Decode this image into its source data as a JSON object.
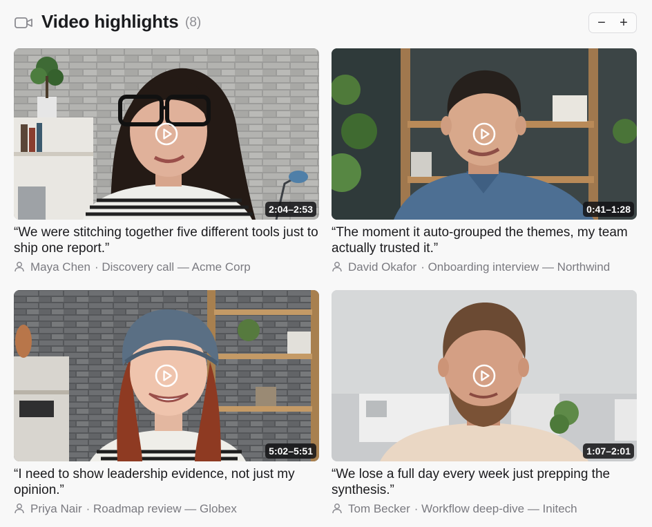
{
  "header": {
    "title": "Video highlights",
    "count": "(8)",
    "icon": "video-camera-icon",
    "zoom_out_label": "−",
    "zoom_in_label": "+"
  },
  "videos": [
    {
      "quote": "“We were stitching together five different tools just to ship one report.”",
      "name": "Maya Chen",
      "source": "· Discovery call — Acme Corp",
      "timestamp": "2:04–2:53"
    },
    {
      "quote": "“The moment it auto-grouped the themes, my team actually trusted it.”",
      "name": "David Okafor",
      "source": "· Onboarding interview — Northwind",
      "timestamp": "0:41–1:28"
    },
    {
      "quote": "“I need to show leadership evidence, not just my opinion.”",
      "name": "Priya Nair",
      "source": "· Roadmap review — Globex",
      "timestamp": "5:02–5:51"
    },
    {
      "quote": "“We lose a full day every week just prepping the synthesis.”",
      "name": "Tom Becker",
      "source": "· Workflow deep-dive — Initech",
      "timestamp": "1:07–2:01"
    }
  ]
}
